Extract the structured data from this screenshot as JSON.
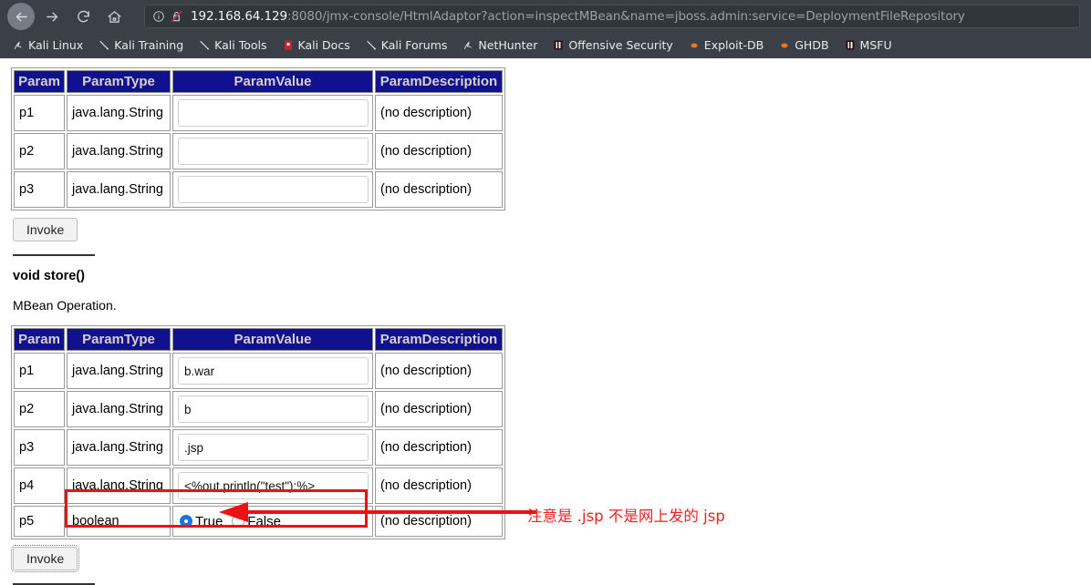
{
  "browser": {
    "nav": {
      "back_label": "Back",
      "forward_label": "Forward",
      "reload_label": "Reload",
      "home_label": "Home"
    },
    "url": {
      "host": "192.168.64.129",
      "rest": ":8080/jmx-console/HtmlAdaptor?action=inspectMBean&name=jboss.admin:service=DeploymentFileRepository",
      "security_state": "insecure"
    },
    "bookmarks": [
      {
        "label": "Kali Linux",
        "icon": "kali-dragon-icon"
      },
      {
        "label": "Kali Training",
        "icon": "kali-pen-icon"
      },
      {
        "label": "Kali Tools",
        "icon": "kali-pen-icon"
      },
      {
        "label": "Kali Docs",
        "icon": "kali-docs-icon"
      },
      {
        "label": "Kali Forums",
        "icon": "kali-pen-icon"
      },
      {
        "label": "NetHunter",
        "icon": "kali-dragon-icon"
      },
      {
        "label": "Offensive Security",
        "icon": "offsec-icon"
      },
      {
        "label": "Exploit-DB",
        "icon": "flame-icon"
      },
      {
        "label": "GHDB",
        "icon": "flame-icon"
      },
      {
        "label": "MSFU",
        "icon": "offsec-icon"
      }
    ],
    "colors": {
      "chrome_bg": "#3b4048",
      "url_bg": "#31353c",
      "insecure": "#c42a4f"
    }
  },
  "page": {
    "table_headers": [
      "Param",
      "ParamType",
      "ParamValue",
      "ParamDescription"
    ],
    "no_description": "(no description)",
    "invoke_label": "Invoke",
    "table_top": {
      "rows": [
        {
          "param": "p1",
          "type": "java.lang.String",
          "value": "",
          "description": "(no description)"
        },
        {
          "param": "p2",
          "type": "java.lang.String",
          "value": "",
          "description": "(no description)"
        },
        {
          "param": "p3",
          "type": "java.lang.String",
          "value": "",
          "description": "(no description)"
        }
      ]
    },
    "operation": {
      "signature": "void store()",
      "description": "MBean Operation."
    },
    "table_store": {
      "rows": [
        {
          "param": "p1",
          "type": "java.lang.String",
          "value": "b.war",
          "description": "(no description)"
        },
        {
          "param": "p2",
          "type": "java.lang.String",
          "value": "b",
          "description": "(no description)"
        },
        {
          "param": "p3",
          "type": "java.lang.String",
          "value": ".jsp",
          "description": "(no description)"
        },
        {
          "param": "p4",
          "type": "java.lang.String",
          "value": "<%out.println(\"test\");%>",
          "description": "(no description)"
        }
      ],
      "bool_row": {
        "param": "p5",
        "type": "boolean",
        "true_label": "True",
        "false_label": "False",
        "selected": "True",
        "description": "(no description)"
      }
    }
  },
  "annotation": {
    "text": "注意是 .jsp  不是网上发的  jsp",
    "color": "#ee2222",
    "target": "p3-paramvalue-row"
  }
}
